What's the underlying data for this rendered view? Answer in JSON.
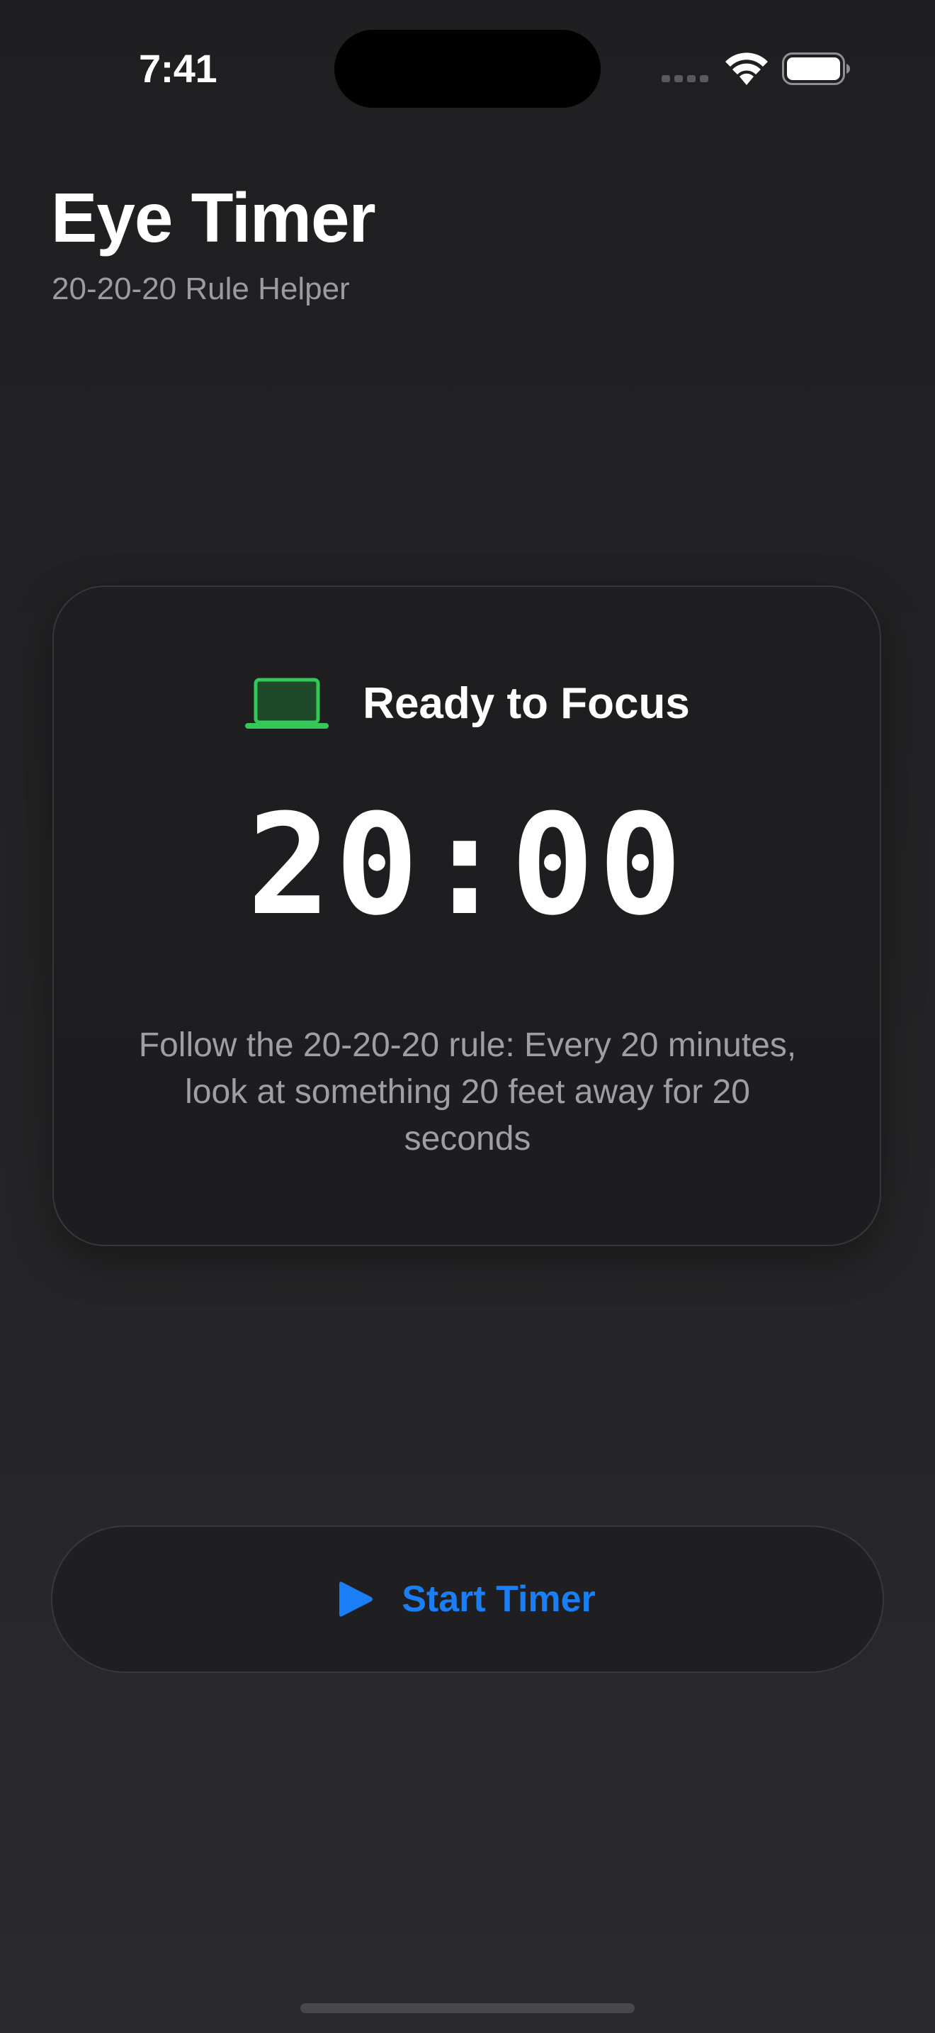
{
  "status_bar": {
    "time": "7:41",
    "icons": [
      "cellular-signal-icon",
      "wifi-icon",
      "battery-icon"
    ]
  },
  "header": {
    "title": "Eye Timer",
    "subtitle": "20-20-20 Rule Helper"
  },
  "timer_card": {
    "status_icon": "laptop-icon",
    "status_label": "Ready to Focus",
    "time_remaining": "20:00",
    "description": "Follow the 20-20-20 rule: Every 20 minutes, look at something 20 feet away for 20 seconds"
  },
  "start_button": {
    "icon": "play-icon",
    "label": "Start Timer"
  },
  "colors": {
    "background": "#232325",
    "card_background": "#1e1e20",
    "accent_blue": "#1a7ff5",
    "status_green": "#34c759",
    "secondary_text": "#9e9ea3"
  }
}
